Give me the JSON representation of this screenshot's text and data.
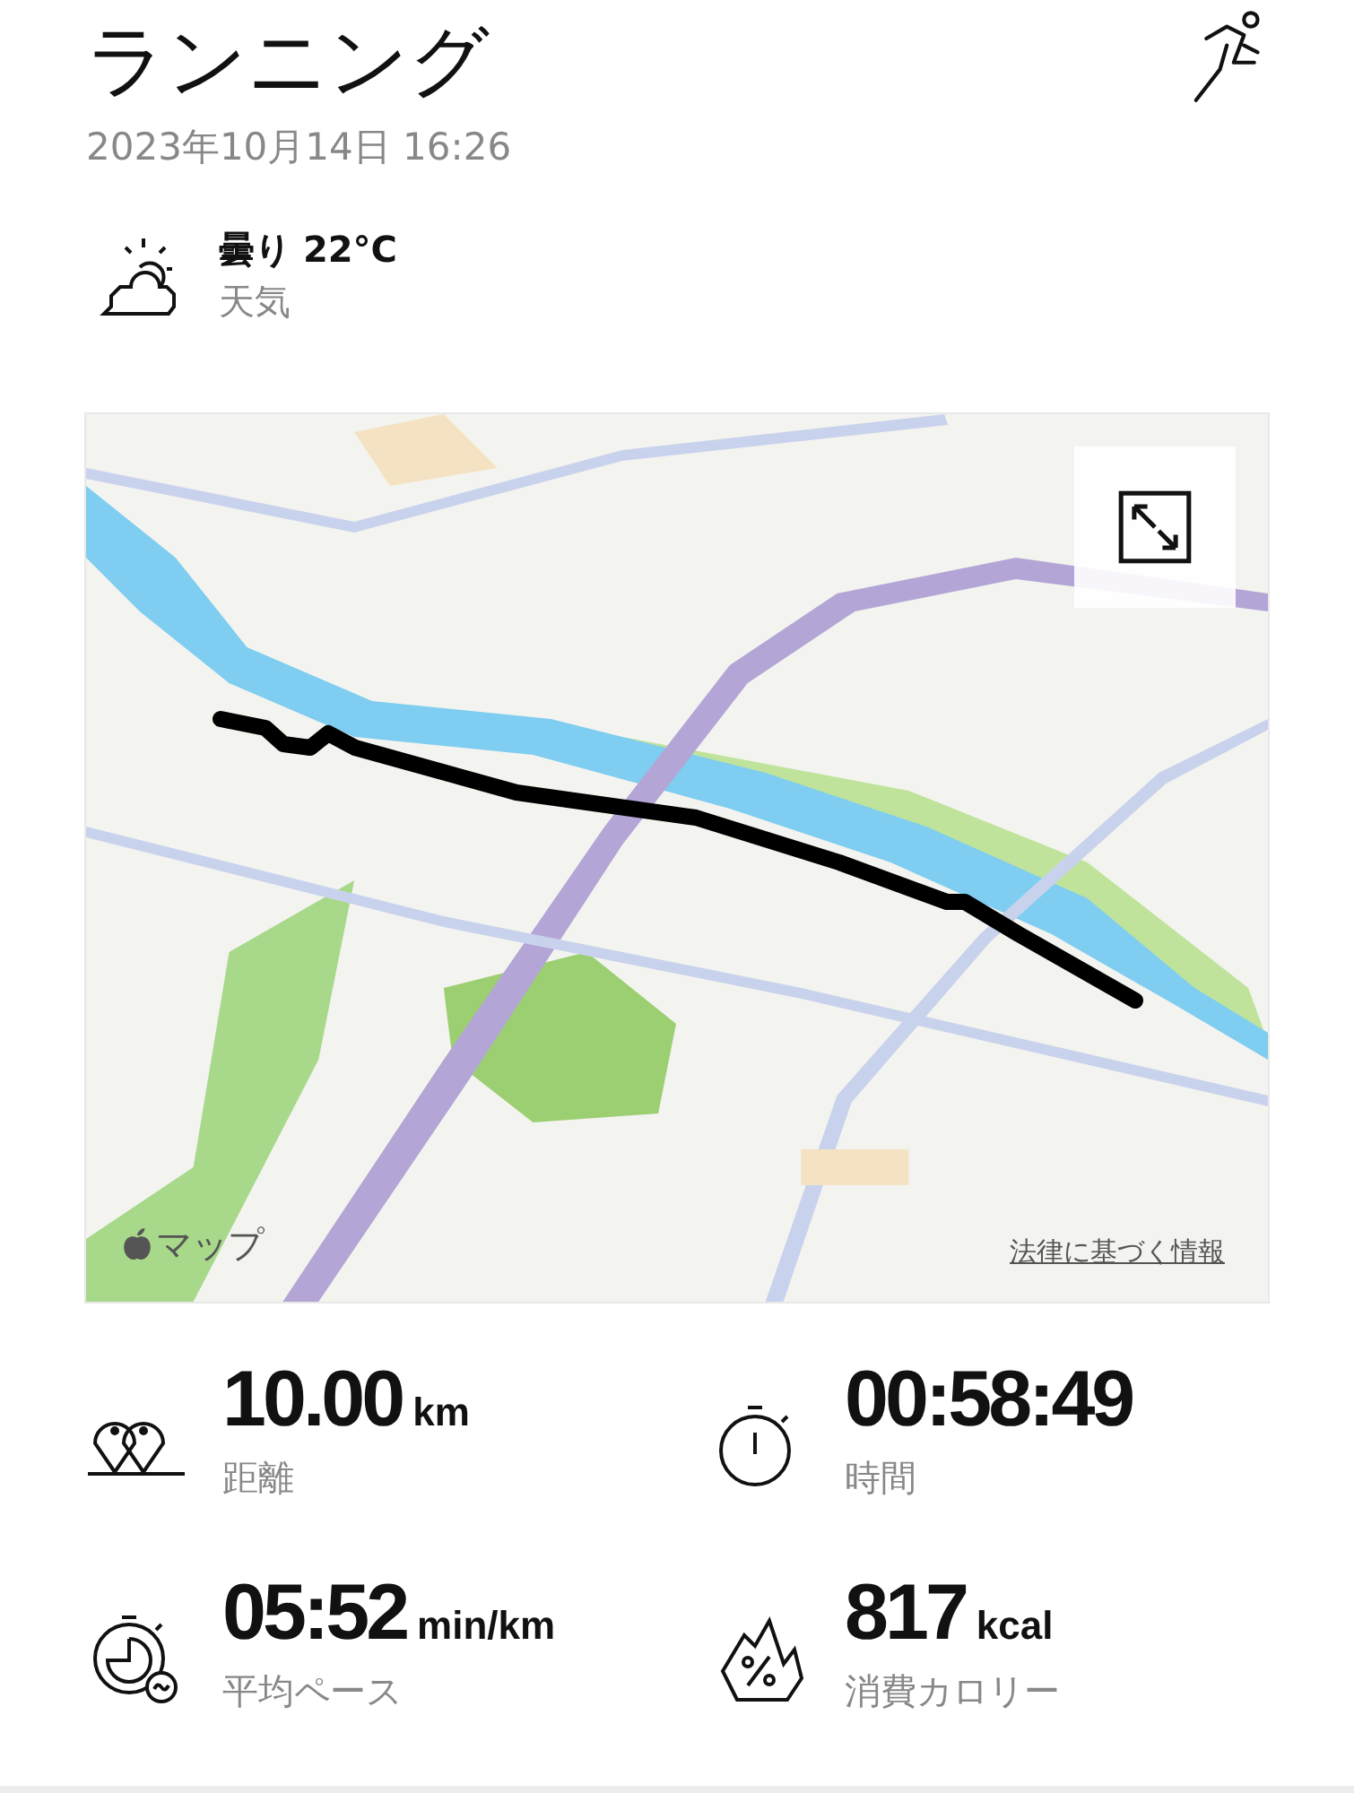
{
  "header": {
    "title": "ランニング",
    "date": "2023年10月14日 16:26"
  },
  "weather": {
    "condition": "曇り 22°C",
    "label": "天気"
  },
  "map": {
    "kind": "picture",
    "attribution": "マップ",
    "legal_link": "法律に基づく情報"
  },
  "stats": [
    {
      "kind": "distance",
      "value": "10.00",
      "unit": "km",
      "label": "距離"
    },
    {
      "kind": "time",
      "value": "00:58:49",
      "label": "時間"
    },
    {
      "kind": "pace",
      "value": "05:52",
      "unit": "min/km",
      "label": "平均ペース"
    },
    {
      "kind": "calories",
      "value": "817",
      "unit": "kcal",
      "label": "消費カロリー"
    }
  ]
}
